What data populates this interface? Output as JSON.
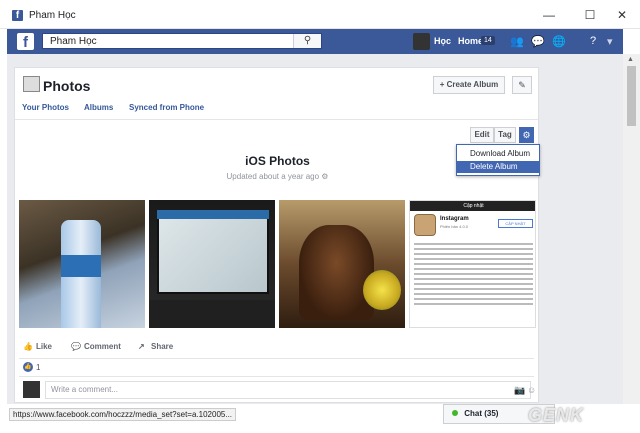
{
  "window": {
    "title": "Pham Học",
    "minimize": "—",
    "maximize": "☐",
    "close": "✕"
  },
  "topbar": {
    "logo": "f",
    "search_value": "Pham Học",
    "search_icon": "⚲",
    "user_name": "Học",
    "home_label": "Home",
    "home_count": "14",
    "icons": [
      "friends-icon",
      "messages-icon",
      "globe-icon",
      "help-icon"
    ]
  },
  "photos": {
    "title": "Photos",
    "create_album": "+ Create Album",
    "edit_icon": "✎",
    "tabs": [
      "Your Photos",
      "Albums",
      "Synced from Phone"
    ],
    "edit_label": "Edit",
    "tag_label": "Tag",
    "gear_icon": "⚙",
    "dropdown": [
      "Download Album",
      "Delete Album"
    ],
    "album_title": "iOS Photos",
    "album_updated": "Updated about a year ago ⚙"
  },
  "photo4": {
    "header": "Cập nhật",
    "app_name": "Instagram",
    "version": "Phiên bản 4.0.0",
    "update_btn": "CẬP NHẬT"
  },
  "actions": {
    "like": "Like",
    "comment": "Comment",
    "share": "Share"
  },
  "likes": {
    "icon": "👍",
    "count": "1"
  },
  "comment": {
    "placeholder": "Write a comment..."
  },
  "statusbar": {
    "url": "https://www.facebook.com/hoczzz/media_set?set=a.102005..."
  },
  "chat": {
    "label": "Chat (35)"
  },
  "watermark": "GENK",
  "colors": {
    "brand": "#3b5998",
    "accent": "#4267b2"
  }
}
